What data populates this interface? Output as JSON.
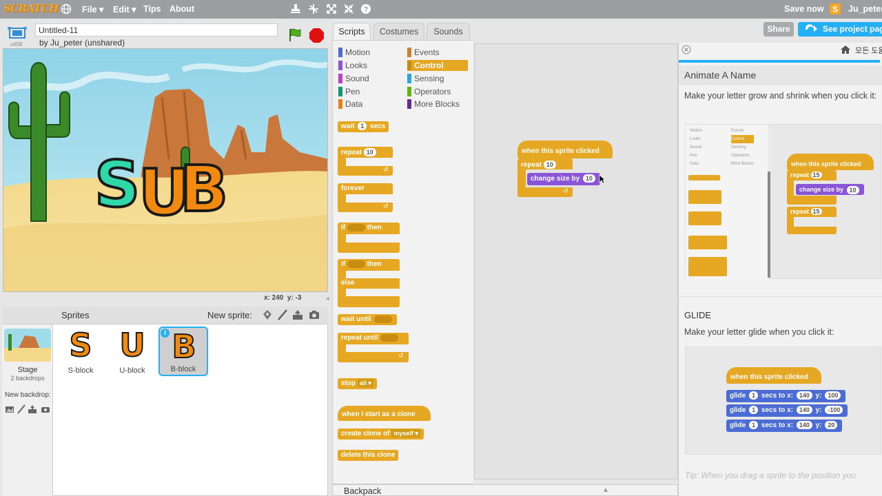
{
  "menubar": {
    "logo": "SCRATCH",
    "items": [
      "File ▾",
      "Edit ▾",
      "Tips",
      "About"
    ],
    "save": "Save now",
    "user": "Ju_peter"
  },
  "topbar": {
    "share": "Share",
    "see_project": "See project page"
  },
  "project": {
    "version": "v458",
    "title": "Untitled-11",
    "owner": "by Ju_peter (unshared)"
  },
  "stage": {
    "letters": [
      "S",
      "U",
      "B"
    ],
    "coords_x": "x: 240",
    "coords_y": "y: -3"
  },
  "sprites": {
    "header": "Sprites",
    "new_sprite": "New sprite:",
    "stage_label": "Stage",
    "stage_backdrops": "2 backdrops",
    "new_backdrop": "New backdrop:",
    "items": [
      {
        "glyph": "S",
        "name": "S-block"
      },
      {
        "glyph": "U",
        "name": "U-block"
      },
      {
        "glyph": "B",
        "name": "B-block"
      }
    ],
    "info_glyph": "i"
  },
  "tabs": [
    "Scripts",
    "Costumes",
    "Sounds"
  ],
  "categories": {
    "left": [
      {
        "label": "Motion",
        "color": "#4a6cd4"
      },
      {
        "label": "Looks",
        "color": "#8a55d7"
      },
      {
        "label": "Sound",
        "color": "#bb42c3"
      },
      {
        "label": "Pen",
        "color": "#0e9a6c"
      },
      {
        "label": "Data",
        "color": "#ee7d16"
      }
    ],
    "right": [
      {
        "label": "Events",
        "color": "#c88330"
      },
      {
        "label": "Control",
        "color": "#e6a822"
      },
      {
        "label": "Sensing",
        "color": "#2ca5e2"
      },
      {
        "label": "Operators",
        "color": "#5cb712"
      },
      {
        "label": "More Blocks",
        "color": "#632d99"
      }
    ]
  },
  "palette": {
    "wait": "wait",
    "wait_n": "1",
    "secs": "secs",
    "repeat": "repeat",
    "repeat_n": "10",
    "forever": "forever",
    "if": "if",
    "then": "then",
    "else": "else",
    "wait_until": "wait until",
    "repeat_until": "repeat until",
    "stop": "stop",
    "stop_opt": "all ▾",
    "clone_start": "when I start as a clone",
    "create_clone": "create clone of",
    "clone_opt": "myself ▾",
    "delete_clone": "delete this clone"
  },
  "script": {
    "hat": "when this sprite clicked",
    "repeat": "repeat",
    "repeat_n": "10",
    "change": "change size by",
    "change_n": "10"
  },
  "backpack": "Backpack",
  "tips": {
    "home_label": "모든 도움",
    "title": "Animate A Name",
    "desc": "Make your letter grow and shrink when you click it:",
    "mini_hat": "when this sprite clicked",
    "mini_repeat": "repeat",
    "mini_repeat_n": "15",
    "mini_change": "change size by",
    "mini_change_n": "10",
    "mini_cats_left": [
      "Motion",
      "Looks",
      "Sound",
      "Pen",
      "Data"
    ],
    "mini_cats_right": [
      "Events",
      "Control",
      "Sensing",
      "Operators",
      "More Blocks"
    ],
    "glide_title": "GLIDE",
    "glide_desc": "Make your letter glide when you click it:",
    "glide_hat": "when this sprite clicked",
    "glide_rows": [
      {
        "glide": "glide",
        "n": "1",
        "secs_to": "secs to x:",
        "x": "140",
        "y_lbl": "y:",
        "y": "100"
      },
      {
        "glide": "glide",
        "n": "1",
        "secs_to": "secs to x:",
        "x": "140",
        "y_lbl": "y:",
        "y": "-100"
      },
      {
        "glide": "glide",
        "n": "1",
        "secs_to": "secs to x:",
        "x": "140",
        "y_lbl": "y:",
        "y": "20"
      }
    ],
    "tip_footer": "Tip: When you drag a sprite to the position you"
  }
}
